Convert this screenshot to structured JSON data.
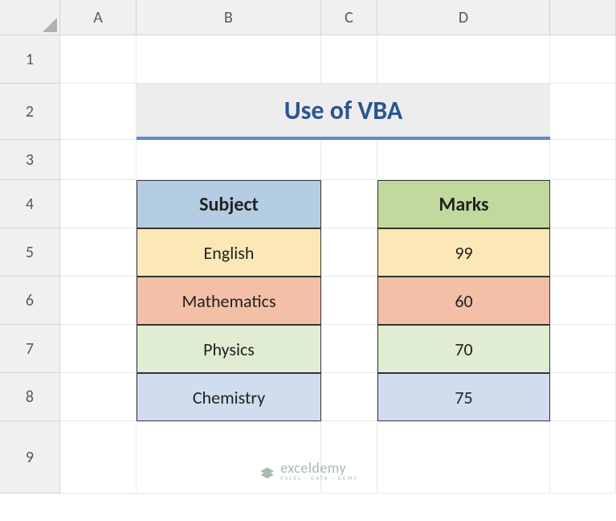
{
  "columns": [
    "A",
    "B",
    "C",
    "D"
  ],
  "rows": [
    "1",
    "2",
    "3",
    "4",
    "5",
    "6",
    "7",
    "8",
    "9"
  ],
  "title": "Use of VBA",
  "table": {
    "headers": {
      "subject": "Subject",
      "marks": "Marks"
    },
    "data": [
      {
        "subject": "English",
        "marks": "99",
        "fill": "yellow"
      },
      {
        "subject": "Mathematics",
        "marks": "60",
        "fill": "orange"
      },
      {
        "subject": "Physics",
        "marks": "70",
        "fill": "green"
      },
      {
        "subject": "Chemistry",
        "marks": "75",
        "fill": "blue"
      }
    ]
  },
  "watermark": {
    "brand": "exceldemy",
    "tag": "EXCEL · DATA · DEMY"
  }
}
